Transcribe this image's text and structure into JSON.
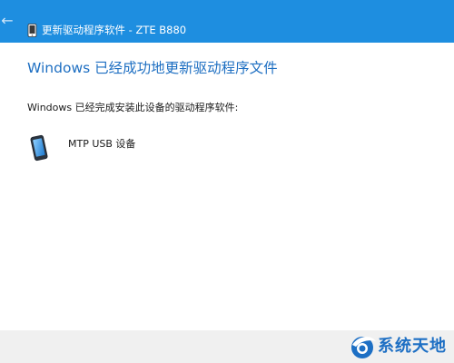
{
  "titlebar": {
    "title": "更新驱动程序软件 - ZTE B880",
    "back_icon": "arrow-left-icon",
    "title_icon": "phone-device-icon",
    "background_color": "#1e8ee0"
  },
  "content": {
    "heading": "Windows 已经成功地更新驱动程序文件",
    "message": "Windows 已经完成安装此设备的驱动程序软件:",
    "device": {
      "icon": "mobile-device-icon",
      "label": "MTP USB 设备"
    },
    "heading_color": "#1e6fc2"
  },
  "watermark": {
    "text": "系统天地",
    "logo_icon": "site-logo-icon",
    "color": "#1d6fc4"
  }
}
